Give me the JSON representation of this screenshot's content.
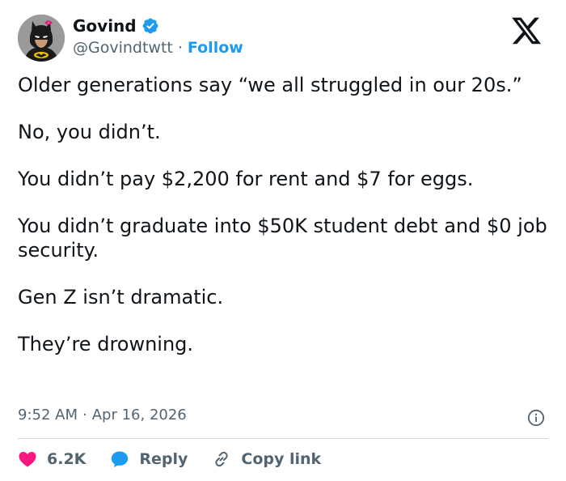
{
  "author": {
    "name": "Govind",
    "handle": "@Govindtwtt",
    "separator": "·",
    "follow_label": "Follow"
  },
  "tweet": {
    "paragraphs": [
      "Older generations say “we all struggled in our 20s.”",
      "No, you didn’t.",
      "You didn’t pay $2,200 for rent and $7 for eggs.",
      "You didn’t graduate into $50K student debt and $0 job security.",
      "Gen Z isn’t dramatic.",
      "They’re drowning."
    ],
    "time": "9:52 AM",
    "separator": "·",
    "date": "Apr 16, 2026"
  },
  "actions": {
    "likes": "6.2K",
    "reply_label": "Reply",
    "copy_link_label": "Copy link"
  },
  "colors": {
    "accent": "#1d9bf0",
    "like": "#f91880",
    "text": "#0f1419",
    "muted": "#536471"
  },
  "icons": [
    "verified-badge-icon",
    "x-logo-icon",
    "info-icon",
    "heart-icon",
    "reply-bubble-icon",
    "link-icon"
  ]
}
